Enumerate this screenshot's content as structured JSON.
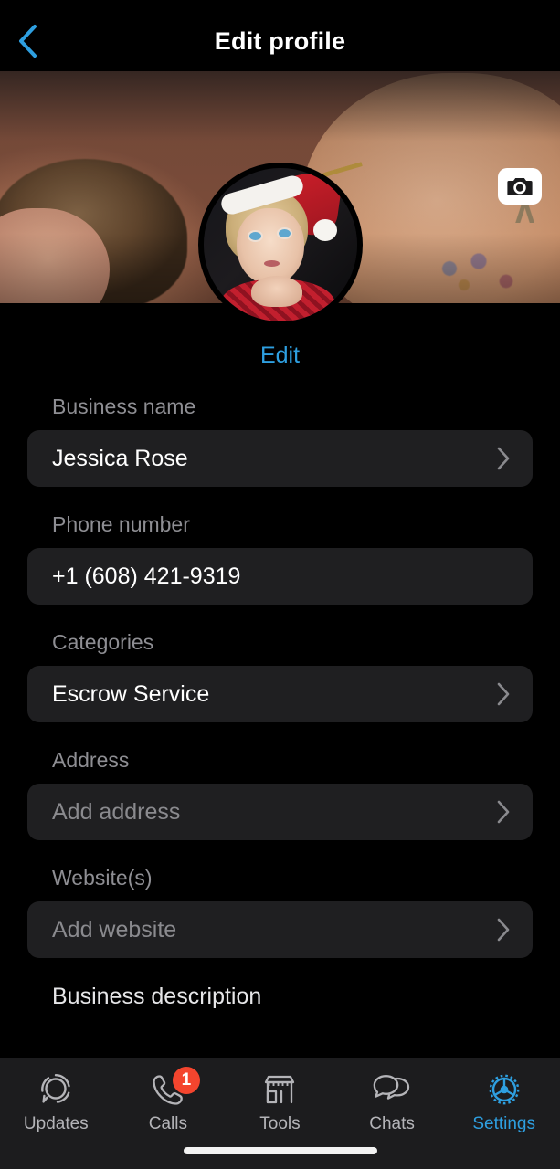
{
  "header": {
    "title": "Edit profile",
    "back_icon": "chevron-left-icon",
    "accent_color": "#2e9fe0"
  },
  "cover": {
    "camera_icon": "camera-icon"
  },
  "profile": {
    "avatar_icon": "profile-avatar",
    "edit_label": "Edit"
  },
  "form": {
    "fields": [
      {
        "label": "Business name",
        "value": "Jessica Rose",
        "is_placeholder": false,
        "chevron": true
      },
      {
        "label": "Phone number",
        "value": "+1 (608) 421-9319",
        "is_placeholder": false,
        "chevron": false
      },
      {
        "label": "Categories",
        "value": "Escrow Service",
        "is_placeholder": false,
        "chevron": true
      },
      {
        "label": "Address",
        "value": "Add address",
        "is_placeholder": true,
        "chevron": true
      },
      {
        "label": "Website(s)",
        "value": "Add website",
        "is_placeholder": true,
        "chevron": true
      }
    ],
    "description_label": "Business description"
  },
  "tabbar": {
    "items": [
      {
        "label": "Updates",
        "icon": "updates-status-icon",
        "active": false,
        "badge": ""
      },
      {
        "label": "Calls",
        "icon": "phone-icon",
        "active": false,
        "badge": "1"
      },
      {
        "label": "Tools",
        "icon": "storefront-icon",
        "active": false,
        "badge": ""
      },
      {
        "label": "Chats",
        "icon": "chat-bubbles-icon",
        "active": false,
        "badge": ""
      },
      {
        "label": "Settings",
        "icon": "gear-icon",
        "active": true,
        "badge": ""
      }
    ],
    "active_color": "#2e9fe0",
    "inactive_color": "#b4b4b8",
    "badge_color": "#f4452e"
  }
}
